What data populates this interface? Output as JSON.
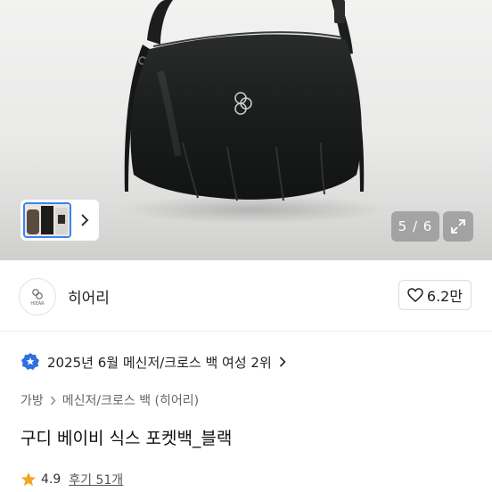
{
  "gallery": {
    "counter": "5 / 6"
  },
  "store": {
    "name": "히어리",
    "logo_text": "HIEAR",
    "like_count": "6.2만"
  },
  "ranking": {
    "text": "2025년 6월 메신저/크로스 백 여성 2위"
  },
  "breadcrumb": {
    "root": "가방",
    "category": "메신저/크로스 백 (히어리)"
  },
  "product": {
    "title": "구디 베이비 식스 포켓백_블랙"
  },
  "rating": {
    "score": "4.9",
    "reviews": "후기 51개"
  },
  "colors": {
    "accent": "#3a82f7",
    "star": "#f5a623",
    "badge": "#2f6fe4"
  }
}
